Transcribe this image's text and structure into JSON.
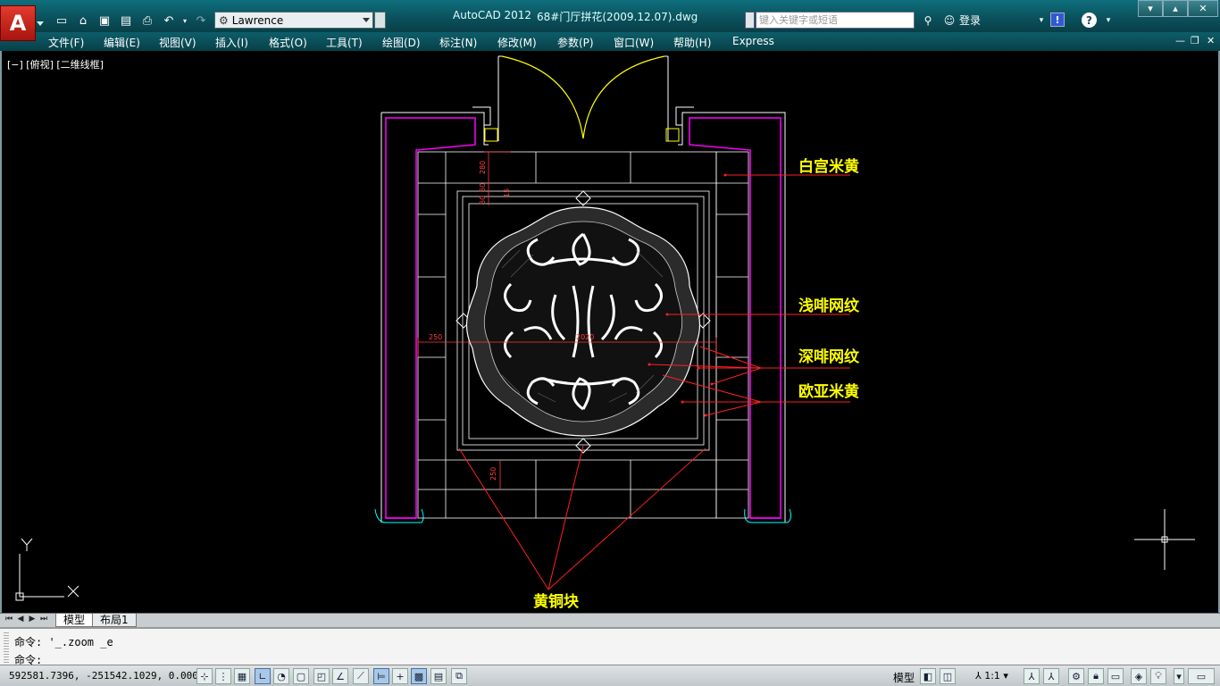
{
  "titlebar": {
    "app_name": "AutoCAD 2012",
    "doc_name": "68#门厅拼花(2009.12.07).dwg",
    "workspace": "Lawrence",
    "search_placeholder": "键入关键字或短语",
    "login_label": "登录"
  },
  "menus": [
    "文件(F)",
    "编辑(E)",
    "视图(V)",
    "插入(I)",
    "格式(O)",
    "工具(T)",
    "绘图(D)",
    "标注(N)",
    "修改(M)",
    "参数(P)",
    "窗口(W)",
    "帮助(H)",
    "Express"
  ],
  "viewport": {
    "label": "[−] [俯视] [二维线框]",
    "ucs_x": "X",
    "ucs_y": "Y"
  },
  "drawing": {
    "annotations": [
      "白宫米黄",
      "浅啡网纹",
      "深啡网纹",
      "欧亚米黄",
      "黄铜块"
    ],
    "dimensions": [
      "280",
      "50",
      "50",
      "15",
      "250",
      "2020",
      "250"
    ]
  },
  "tabs": [
    "模型",
    "布局1"
  ],
  "command": {
    "history": "命令: '_.zoom _e",
    "prompt": "命令:"
  },
  "status": {
    "coordinates": "592581.7396, -251542.1029, 0.0000",
    "model_label": "模型",
    "annotation_scale": "1:1"
  },
  "colors": {
    "accent_title": "#0a4f5a",
    "annotation_text": "#ffff00",
    "leader": "#ff0000",
    "wall": "#ff00ff",
    "door_arc": "#ffff00",
    "lines": "#ffffff"
  }
}
